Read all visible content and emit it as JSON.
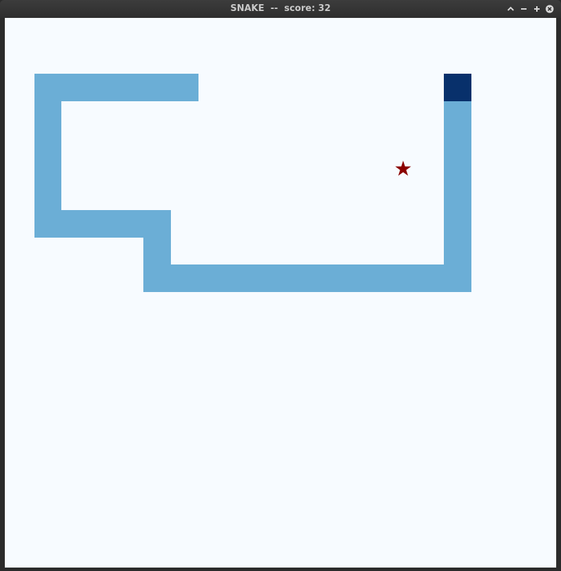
{
  "window": {
    "title": "SNAKE  --  score: 32"
  },
  "icons": {
    "maximize": "chevron-up-icon",
    "minimize": "minus-icon",
    "restore": "plus-icon",
    "close": "close-circle-icon"
  },
  "game": {
    "score": 32,
    "direction": "up",
    "colors": {
      "background": "#f7fbff",
      "snake_body": "#6baed6",
      "snake_head": "#08306b",
      "food": "#8b0000"
    },
    "food_symbol": "★"
  }
}
